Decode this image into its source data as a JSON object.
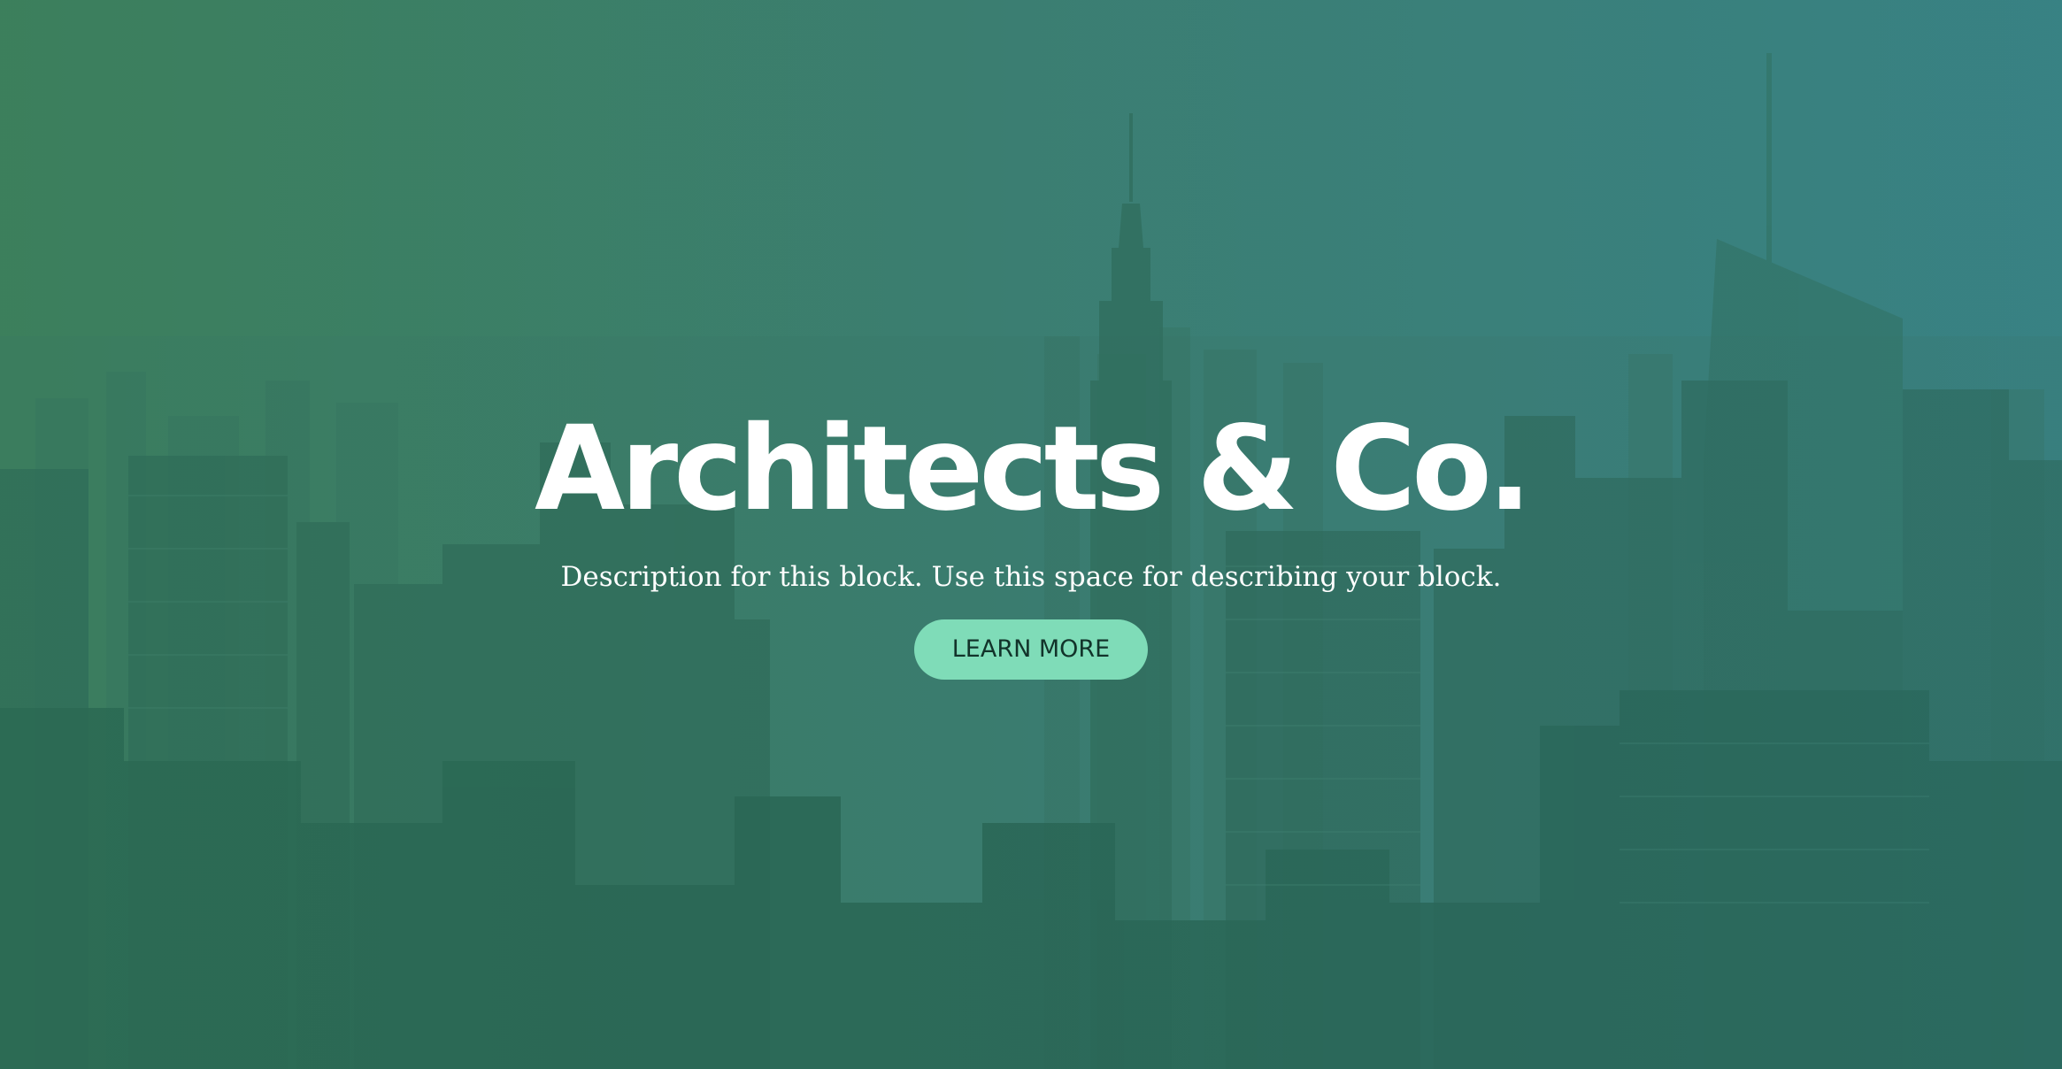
{
  "hero": {
    "title": "Architects & Co.",
    "description": "Description for this block. Use this space for describing your block.",
    "cta_label": "LEARN MORE",
    "background_image": "city-skyline-image"
  },
  "colors": {
    "gradient_left": "#3f7f5c",
    "gradient_right": "#3b8384",
    "button_background": "#7fdcb8",
    "button_text": "#12332a",
    "title_text": "#ffffff"
  }
}
